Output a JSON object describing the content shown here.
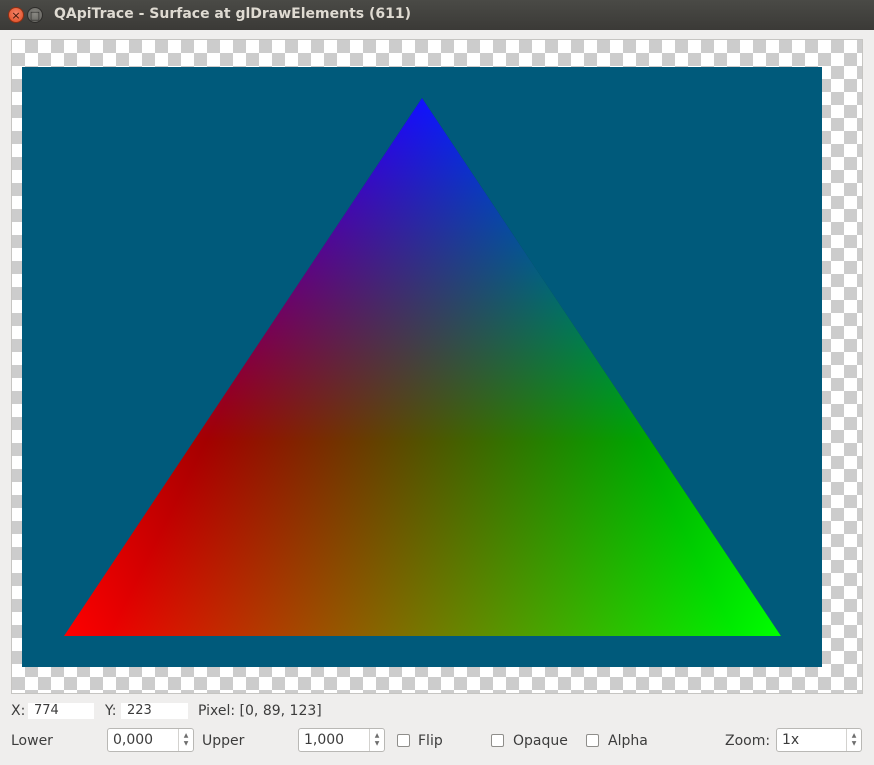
{
  "window": {
    "title": "QApiTrace - Surface at glDrawElements (611)",
    "close_glyph": "×",
    "max_glyph": "□"
  },
  "surface": {
    "clear_color": "#005a7b",
    "vertex_colors": {
      "top": "#0000ff",
      "bottom_left": "#ff0000",
      "bottom_right": "#00ff00"
    }
  },
  "status": {
    "x_label": "X:",
    "x_value": "774",
    "y_label": "Y:",
    "y_value": "223",
    "pixel_text": "Pixel: [0, 89, 123]"
  },
  "controls": {
    "lower_label": "Lower",
    "lower_value": "0,000",
    "upper_label": "Upper",
    "upper_value": "1,000",
    "flip_label": "Flip",
    "opaque_label": "Opaque",
    "alpha_label": "Alpha",
    "zoom_label": "Zoom:",
    "zoom_value": "1x",
    "spin_up": "▲",
    "spin_down": "▼"
  }
}
